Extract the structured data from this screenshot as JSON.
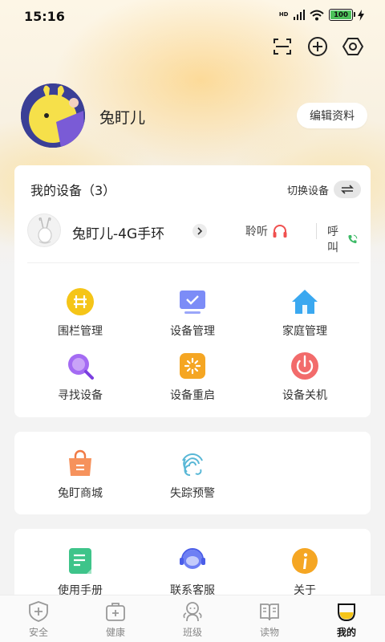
{
  "status_bar": {
    "time": "15:16",
    "network": "HD",
    "battery": "100"
  },
  "profile": {
    "name": "兔盯儿",
    "edit_label": "编辑资料"
  },
  "devices_card": {
    "title": "我的设备（3）",
    "switch_label": "切换设备",
    "device_name": "兔盯儿-4G手环",
    "listen_label": "聆听",
    "call_label": "呼叫",
    "features": [
      {
        "label": "围栏管理",
        "icon": "fence-icon",
        "color": "#f5c518"
      },
      {
        "label": "设备管理",
        "icon": "monitor-check-icon",
        "color": "#6f7ff5"
      },
      {
        "label": "家庭管理",
        "icon": "home-icon",
        "color": "#3aa8f0"
      },
      {
        "label": "寻找设备",
        "icon": "search-device-icon",
        "color": "#9b5cf0"
      },
      {
        "label": "设备重启",
        "icon": "restart-icon",
        "color": "#f5a623"
      },
      {
        "label": "设备关机",
        "icon": "power-icon",
        "color": "#f06060"
      }
    ]
  },
  "services_card": {
    "items": [
      {
        "label": "兔盯商城",
        "icon": "shopping-bag-icon"
      },
      {
        "label": "失踪预警",
        "icon": "fingerprint-icon"
      }
    ]
  },
  "help_card": {
    "items": [
      {
        "label": "使用手册",
        "icon": "manual-icon"
      },
      {
        "label": "联系客服",
        "icon": "customer-service-icon"
      },
      {
        "label": "关于",
        "icon": "info-icon"
      }
    ]
  },
  "nav": {
    "items": [
      {
        "label": "安全",
        "icon": "shield-icon"
      },
      {
        "label": "健康",
        "icon": "medical-kit-icon"
      },
      {
        "label": "班级",
        "icon": "class-icon"
      },
      {
        "label": "读物",
        "icon": "book-icon"
      },
      {
        "label": "我的",
        "icon": "me-icon"
      }
    ],
    "active": "我的"
  },
  "colors": {
    "accent": "#f5c518",
    "background": "#f3f3f3",
    "card": "#ffffff"
  }
}
